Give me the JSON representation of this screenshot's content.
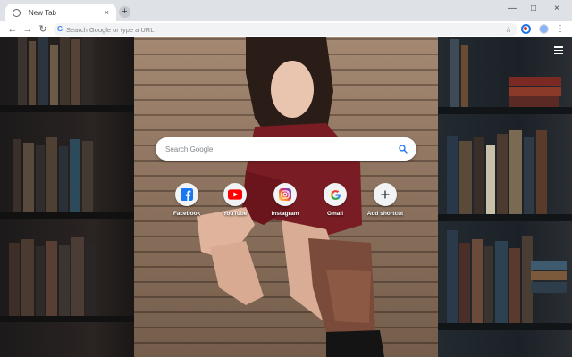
{
  "tab": {
    "title": "New Tab",
    "favicon": "globe-icon",
    "close_icon": "×",
    "new_tab_icon": "+"
  },
  "window": {
    "minimize": "—",
    "maximize": "□",
    "close": "×"
  },
  "toolbar": {
    "back": "←",
    "forward": "→",
    "reload": "↻",
    "omnibox_placeholder": "Search Google or type a URL",
    "star": "☆",
    "menu": "⋮"
  },
  "ntp": {
    "search_placeholder": "Search Google",
    "shortcuts": [
      {
        "label": "Facebook",
        "icon": "facebook-icon",
        "color": "#1877f2"
      },
      {
        "label": "YouTube",
        "icon": "youtube-icon",
        "color": "#ff0000"
      },
      {
        "label": "Instagram",
        "icon": "instagram-icon",
        "color": "#c13584"
      },
      {
        "label": "Gmail",
        "icon": "google-icon",
        "color": "#4285f4"
      },
      {
        "label": "Add shortcut",
        "icon": "plus-icon",
        "color": "#3c4043"
      }
    ]
  },
  "colors": {
    "accent": "#1a73e8",
    "toolbar": "#ffffff",
    "tabstrip": "#dee1e6"
  }
}
